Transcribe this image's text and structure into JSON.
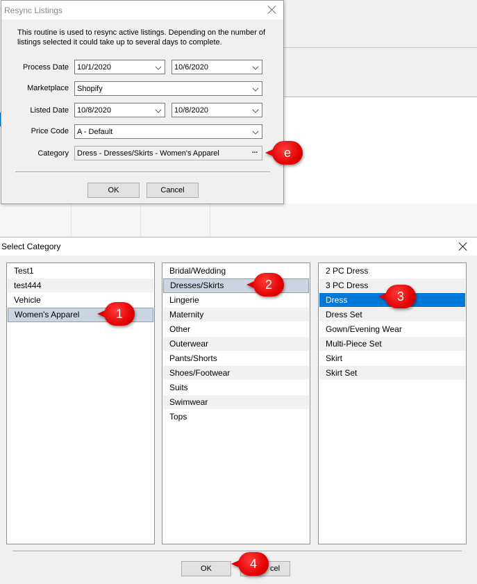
{
  "resync_dialog": {
    "title": "Resync Listings",
    "intro": "This routine is used to resync active listings. Depending on the number of listings selected it could take up to several days to complete.",
    "process_date": {
      "label": "Process Date",
      "from": "10/1/2020",
      "to": "10/6/2020"
    },
    "marketplace": {
      "label": "Marketplace",
      "value": "Shopify"
    },
    "listed_date": {
      "label": "Listed Date",
      "from": "10/8/2020",
      "to": "10/8/2020"
    },
    "price_code": {
      "label": "Price Code",
      "value": "A - Default"
    },
    "category": {
      "label": "Category",
      "value": "Dress - Dresses/Skirts - Women's Apparel",
      "browse": "..."
    },
    "ok_label": "OK",
    "cancel_label": "Cancel"
  },
  "select_category_dialog": {
    "title": "Select Category",
    "column1": [
      "Test1",
      "test444",
      "Vehicle",
      "Women's Apparel"
    ],
    "column2": [
      "Bridal/Wedding",
      "Dresses/Skirts",
      "Lingerie",
      "Maternity",
      "Other",
      "Outerwear",
      "Pants/Shorts",
      "Shoes/Footwear",
      "Suits",
      "Swimwear",
      "Tops"
    ],
    "column3": [
      "2 PC Dress",
      "3 PC Dress",
      "Dress",
      "Dress Set",
      "Gown/Evening Wear",
      "Multi-Piece Set",
      "Skirt",
      "Skirt Set"
    ],
    "selected": {
      "column1": "Women's Apparel",
      "column2": "Dresses/Skirts",
      "column3": "Dress"
    },
    "ok_label": "OK",
    "cancel_label": "Cancel",
    "cancel_visible_fragment": "cel"
  },
  "callouts": {
    "e": "e",
    "one": "1",
    "two": "2",
    "three": "3",
    "four": "4"
  },
  "colors": {
    "selection_blue": "#0078d7",
    "selection_gray": "#cbd5e1",
    "callout_red": "#e00000",
    "dialog_bg": "#f0f0f0"
  }
}
